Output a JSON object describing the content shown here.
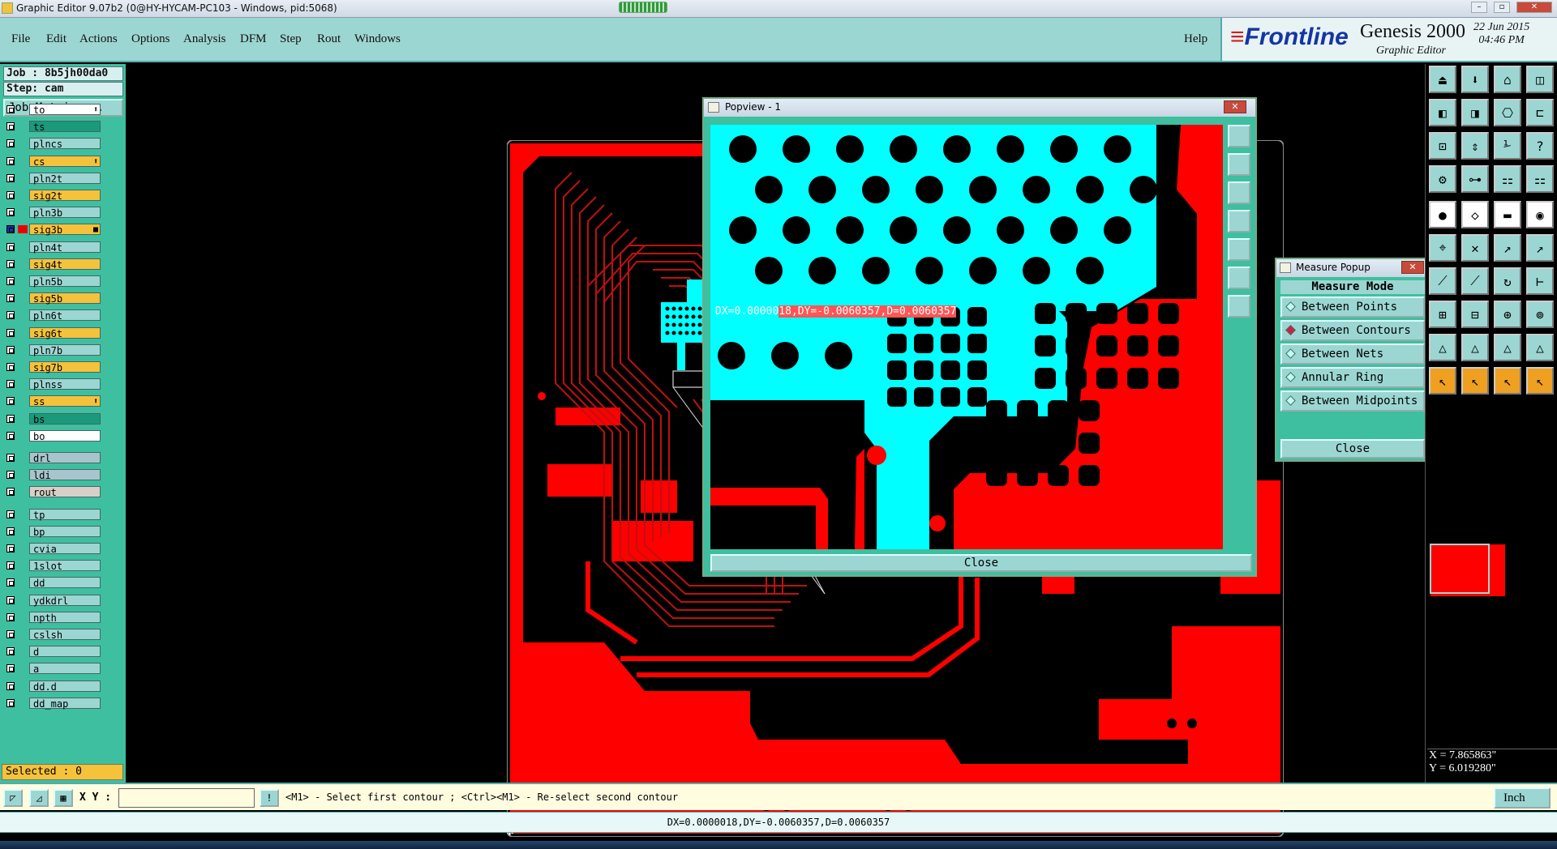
{
  "window": {
    "title": "Graphic Editor 9.07b2 (0@HY-HYCAM-PC103 - Windows, pid:5068)",
    "controls": [
      "–",
      "▫",
      "✕"
    ]
  },
  "menu": [
    "File",
    "Edit",
    "Actions",
    "Options",
    "Analysis",
    "DFM",
    "Step",
    "Rout",
    "Windows"
  ],
  "help": "Help",
  "logo": {
    "brand": "Frontline",
    "product": "Genesis 2000",
    "subtitle": "Graphic Editor",
    "date": "22 Jun 2015",
    "time": "04:46 PM"
  },
  "job": "Job : 8b5jh00da0",
  "step": "Step: cam",
  "job_matrix": "Job Matrix ...",
  "layers": [
    {
      "name": "to",
      "color": "#ffffff",
      "mark": "⬆"
    },
    {
      "name": "ts",
      "color": "#1a9a7a",
      "mark": ""
    },
    {
      "name": "plncs",
      "color": "#9cd6d2",
      "mark": ""
    },
    {
      "name": "cs",
      "color": "#f5c23c",
      "mark": "⬆"
    },
    {
      "name": "pln2t",
      "color": "#9cd6d2",
      "mark": ""
    },
    {
      "name": "sig2t",
      "color": "#f5c23c",
      "mark": ""
    },
    {
      "name": "pln3b",
      "color": "#9cd6d2",
      "mark": ""
    },
    {
      "name": "sig3b",
      "color": "#f5c23c",
      "mark": "■"
    },
    {
      "name": "pln4t",
      "color": "#9cd6d2",
      "mark": ""
    },
    {
      "name": "sig4t",
      "color": "#f5c23c",
      "mark": ""
    },
    {
      "name": "pln5b",
      "color": "#9cd6d2",
      "mark": ""
    },
    {
      "name": "sig5b",
      "color": "#f5c23c",
      "mark": ""
    },
    {
      "name": "pln6t",
      "color": "#9cd6d2",
      "mark": ""
    },
    {
      "name": "sig6t",
      "color": "#f5c23c",
      "mark": ""
    },
    {
      "name": "pln7b",
      "color": "#9cd6d2",
      "mark": ""
    },
    {
      "name": "sig7b",
      "color": "#f5c23c",
      "mark": ""
    },
    {
      "name": "plnss",
      "color": "#9cd6d2",
      "mark": ""
    },
    {
      "name": "ss",
      "color": "#f5c23c",
      "mark": "⬆"
    },
    {
      "name": "bs",
      "color": "#1a9a7a",
      "mark": ""
    },
    {
      "name": "bo",
      "color": "#ffffff",
      "mark": ""
    },
    {
      "name": "drl",
      "color": "#a8c4cc",
      "mark": ""
    },
    {
      "name": "ldi",
      "color": "#a8c4cc",
      "mark": ""
    },
    {
      "name": "rout",
      "color": "#d8d0c8",
      "mark": ""
    },
    {
      "name": "tp",
      "color": "#9cd6d2",
      "mark": ""
    },
    {
      "name": "bp",
      "color": "#9cd6d2",
      "mark": ""
    },
    {
      "name": "cvia",
      "color": "#9cd6d2",
      "mark": ""
    },
    {
      "name": "1slot",
      "color": "#9cd6d2",
      "mark": ""
    },
    {
      "name": "dd",
      "color": "#9cd6d2",
      "mark": ""
    },
    {
      "name": "ydkdrl",
      "color": "#9cd6d2",
      "mark": ""
    },
    {
      "name": "npth",
      "color": "#9cd6d2",
      "mark": ""
    },
    {
      "name": "cslsh",
      "color": "#9cd6d2",
      "mark": ""
    },
    {
      "name": "d",
      "color": "#9cd6d2",
      "mark": ""
    },
    {
      "name": "a",
      "color": "#9cd6d2",
      "mark": ""
    },
    {
      "name": "dd.d",
      "color": "#9cd6d2",
      "mark": ""
    },
    {
      "name": "dd_map",
      "color": "#9cd6d2",
      "mark": ""
    }
  ],
  "selected": "Selected : 0",
  "popview": {
    "title": "Popview - 1",
    "readout_prefix": "DX=0.00000",
    "readout_rest": "18,DY=-0.0060357,D=0.0060357",
    "close": "Close"
  },
  "measure": {
    "title": "Measure Popup",
    "mode_label": "Measure Mode",
    "options": [
      "Between Points",
      "Between Contours",
      "Between Nets",
      "Annular Ring",
      "Between Midpoints"
    ],
    "selected_option": "Between Contours",
    "close": "Close"
  },
  "coords": {
    "x": "X = 7.865863\"",
    "y": "Y = 6.019280\""
  },
  "command": {
    "xy_label": "X Y :",
    "xy_value": "",
    "prompt": "<M1> - Select first contour ; <Ctrl><M1> - Re-select second contour",
    "units": "Inch"
  },
  "status": "DX=0.0000018,DY=-0.0060357,D=0.0060357",
  "colors": {
    "copper": "#ff0000",
    "highlight": "#00ffff",
    "panel": "#3ebf9f",
    "button": "#9cd6d2"
  }
}
